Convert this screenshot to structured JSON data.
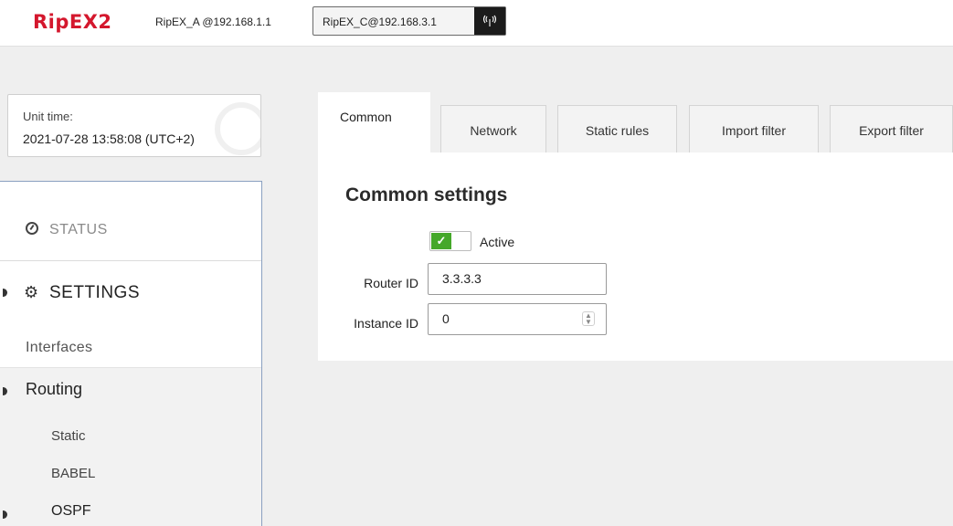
{
  "header": {
    "logo": "RipEX2",
    "unit_a": "RipEX_A @192.168.1.1",
    "unit_c": "RipEX_C@192.168.3.1",
    "signal_icon": "signal-icon"
  },
  "unit_time": {
    "label": "Unit time:",
    "value": "2021-07-28 13:58:08 (UTC+2)"
  },
  "sidebar": {
    "status": "STATUS",
    "settings": "SETTINGS",
    "interfaces": "Interfaces",
    "routing": "Routing",
    "static": "Static",
    "babel": "BABEL",
    "ospf": "OSPF"
  },
  "tabs": [
    "Common",
    "Network",
    "Static rules",
    "Import filter",
    "Export filter"
  ],
  "content": {
    "title": "Common settings",
    "active_label": "Active",
    "active": true,
    "router_id_label": "Router ID",
    "router_id": "3.3.3.3",
    "instance_id_label": "Instance ID",
    "instance_id": "0"
  },
  "colors": {
    "brand": "#d4172d",
    "toggle_on": "#45a82a"
  }
}
